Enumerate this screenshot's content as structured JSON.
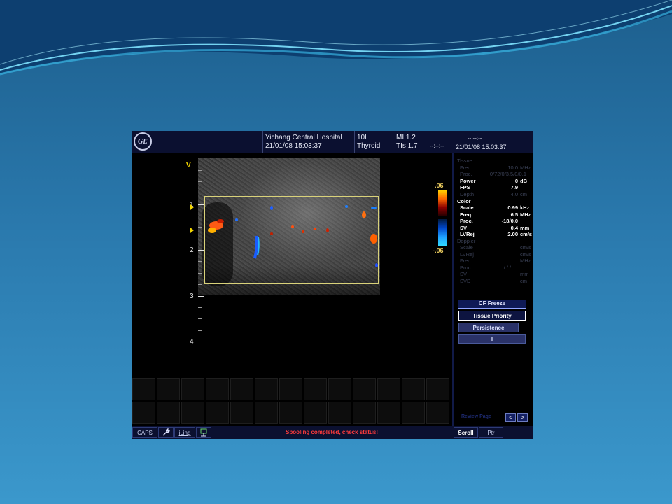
{
  "header": {
    "logo_text": "GE",
    "hospital": "Yichang Central Hospital",
    "datetime": "21/01/08 15:03:37",
    "probe": "10L",
    "preset": "Thyroid",
    "mi": "MI 1.2",
    "tis": "TIs 1.7",
    "timer_placeholder": "--:--:--",
    "right_timer": "--:--:--",
    "right_datetime": "21/01/08 15:03:37"
  },
  "image": {
    "v_marker": "V",
    "depth_labels": [
      "1",
      "2",
      "3",
      "4"
    ],
    "color_scale_top": ".06",
    "color_scale_bottom": "-.06"
  },
  "params": {
    "tissue": {
      "title": "Tissue",
      "rows": [
        {
          "label": "Freq.",
          "value": "10.0",
          "unit": "MHz",
          "active": false
        },
        {
          "label": "Proc.",
          "value": "0/72/0/3.5/0/0.1",
          "unit": "",
          "active": false
        },
        {
          "label": "Power",
          "value": "0",
          "unit": "dB",
          "active": true
        },
        {
          "label": "FPS",
          "value": "7.9",
          "unit": "",
          "active": true
        },
        {
          "label": "Depth",
          "value": "4.0",
          "unit": "cm",
          "active": false
        }
      ]
    },
    "color": {
      "title": "Color",
      "rows": [
        {
          "label": "Scale",
          "value": "0.99",
          "unit": "kHz",
          "active": true
        },
        {
          "label": "Freq.",
          "value": "6.5",
          "unit": "MHz",
          "active": true
        },
        {
          "label": "Proc.",
          "value": "-18/0.0",
          "unit": "",
          "active": true
        },
        {
          "label": "SV",
          "value": "0.4",
          "unit": "mm",
          "active": true
        },
        {
          "label": "LVRej",
          "value": "2.00",
          "unit": "cm/s",
          "active": true
        }
      ]
    },
    "doppler": {
      "title": "Doppler",
      "rows": [
        {
          "label": "Scale",
          "value": "",
          "unit": "cm/s",
          "active": false
        },
        {
          "label": "LVRej",
          "value": "",
          "unit": "cm/s",
          "active": false
        },
        {
          "label": "Freq.",
          "value": "",
          "unit": "MHz",
          "active": false
        },
        {
          "label": "Proc.",
          "value": "/ / /",
          "unit": "",
          "active": false
        },
        {
          "label": "SV",
          "value": "",
          "unit": "mm",
          "active": false
        },
        {
          "label": "SVD",
          "value": "",
          "unit": "cm",
          "active": false
        }
      ]
    }
  },
  "menu": {
    "title": "CF Freeze",
    "items": [
      "Tissue Priority",
      "Persistence",
      "I"
    ],
    "review_label": "Review Page",
    "prev": "<",
    "next": ">"
  },
  "status": {
    "caps": "CAPS",
    "iling": "iLing",
    "message": "Spooling completed, check status!",
    "scroll": "Scroll",
    "ptr": "Ptr"
  },
  "colors": {
    "message": "#ff3b3b",
    "roi_border": "#d9d27a",
    "marker": "#f2d500"
  }
}
